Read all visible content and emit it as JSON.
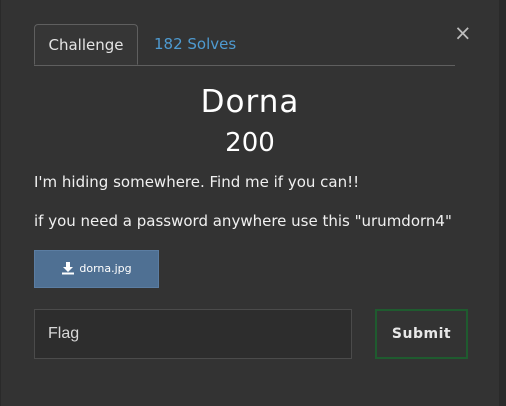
{
  "modal": {
    "close_glyph": "×",
    "tabs": [
      {
        "label": "Challenge"
      },
      {
        "label": "182 Solves"
      }
    ],
    "challenge": {
      "name": "Dorna",
      "value": "200",
      "description": [
        "I'm hiding somewhere. Find me if you can!!",
        "if you need a password anywhere use this \"urumdorn4\""
      ],
      "file": {
        "label": "dorna.jpg",
        "icon": "download-icon"
      }
    },
    "flag_input": {
      "placeholder": "Flag",
      "value": ""
    },
    "submit_label": "Submit",
    "colors": {
      "modal_bg": "#333333",
      "link": "#4e9ad0",
      "file_button": "#4f7093",
      "submit_border": "#1f5b2f"
    }
  }
}
